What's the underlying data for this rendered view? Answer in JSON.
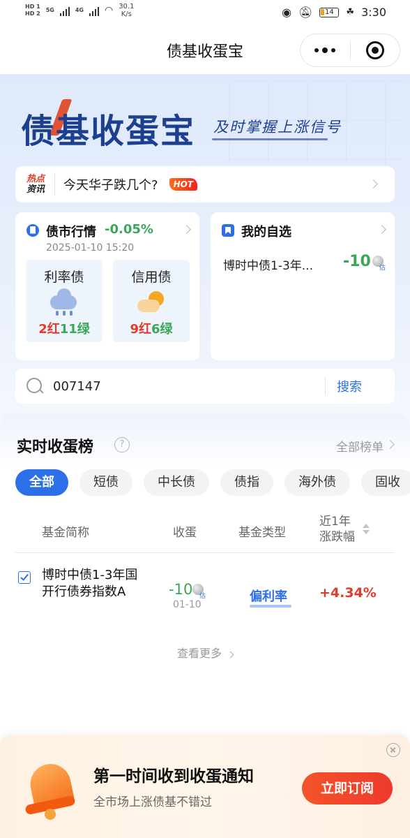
{
  "status_bar": {
    "hd1": "HD 1",
    "hd2": "HD 2",
    "net1": "5G",
    "net2": "4G",
    "speed_value": "30.1",
    "speed_unit": "K/s",
    "battery": "14",
    "time": "3:30"
  },
  "nav": {
    "title": "债基收蛋宝"
  },
  "hero": {
    "brand": "债基收蛋宝",
    "slogan": "及时掌握上涨信号"
  },
  "news": {
    "tag_line1": "热点",
    "tag_line2": "资讯",
    "text": "今天华子跌几个?",
    "badge": "HOT"
  },
  "market": {
    "title": "债市行情",
    "change": "-0.05%",
    "time": "2025-01-10 15:20",
    "items": [
      {
        "name": "利率债",
        "red": "2红",
        "green": "11绿",
        "weather": "rain"
      },
      {
        "name": "信用债",
        "red": "9红",
        "green": "6绿",
        "weather": "sunny-cloud"
      }
    ]
  },
  "watchlist": {
    "title": "我的自选",
    "fund": "博时中债1-3年...",
    "value": "-10",
    "est": "估"
  },
  "search": {
    "value": "007147",
    "button": "搜索"
  },
  "ranking": {
    "title": "实时收蛋榜",
    "all_label": "全部榜单",
    "tabs": [
      {
        "label": "全部",
        "active": true
      },
      {
        "label": "短债",
        "active": false
      },
      {
        "label": "中长债",
        "active": false
      },
      {
        "label": "债指",
        "active": false
      },
      {
        "label": "海外债",
        "active": false
      },
      {
        "label": "固收",
        "active": false
      }
    ],
    "headers": {
      "name": "基金简称",
      "eggs": "收蛋",
      "type": "基金类型",
      "change_line1": "近1年",
      "change_line2": "涨跌幅"
    },
    "rows": [
      {
        "name": "博时中债1-3年国开行债券指数A",
        "eggs": "-10",
        "est": "估",
        "date": "01-10",
        "type": "偏利率",
        "change": "+4.34%",
        "checked": true
      }
    ],
    "more": "查看更多"
  },
  "notify": {
    "title": "第一时间收到收蛋通知",
    "subtitle": "全市场上涨债基不错过",
    "button": "立即订阅"
  },
  "colors": {
    "accent": "#2d6fe8",
    "up": "#e23b2b",
    "down": "#3aa657",
    "brand": "#1c3f8f"
  }
}
